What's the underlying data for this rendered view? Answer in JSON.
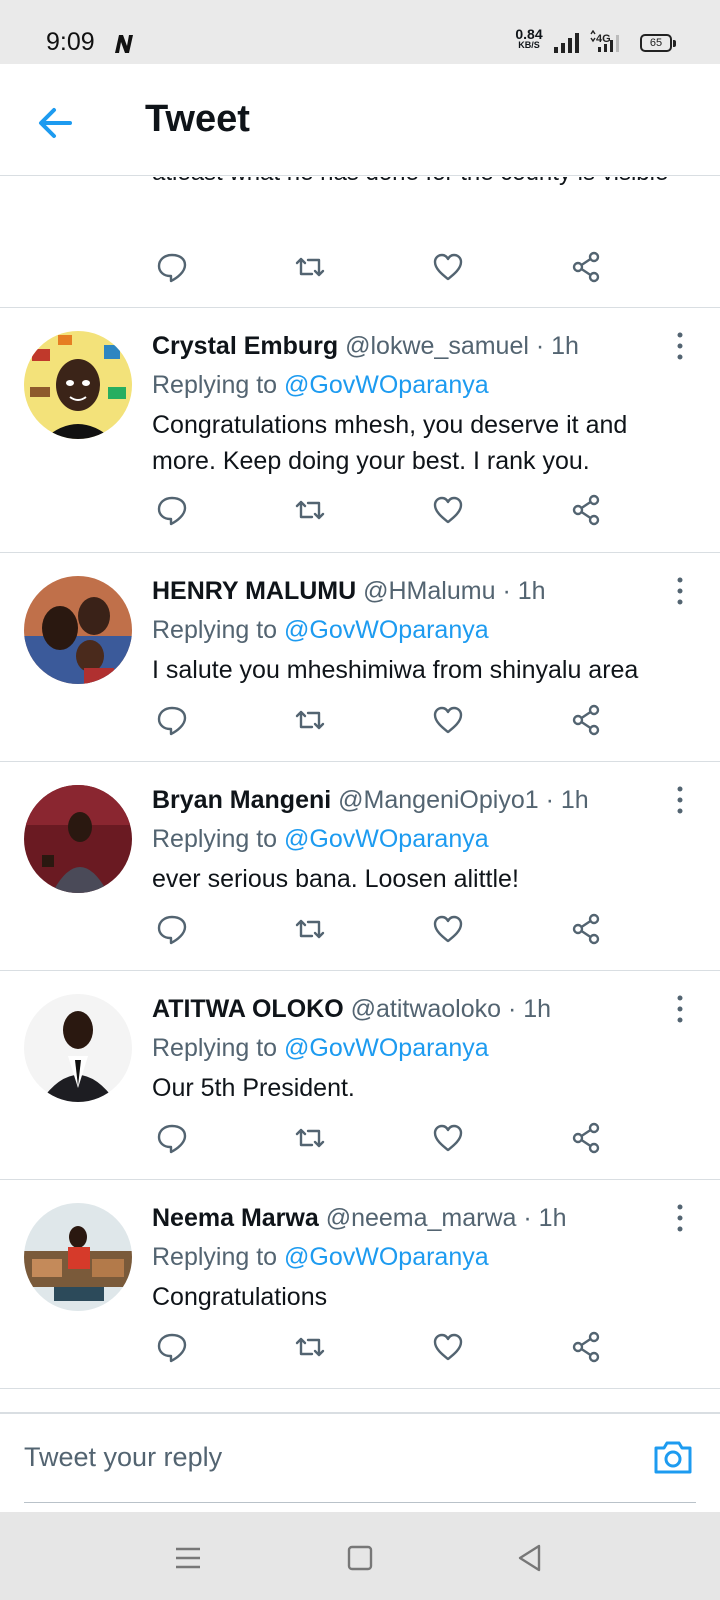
{
  "status_bar": {
    "time": "9:09",
    "net_speed_value": "0.84",
    "net_speed_unit": "KB/S",
    "network_type": "4G",
    "battery": "65"
  },
  "header": {
    "title": "Tweet",
    "back_icon": "arrow-left-icon"
  },
  "partial_tweet": {
    "text": "atleast what he has done for the county is visible"
  },
  "replies": [
    {
      "name": "Crystal Emburg",
      "handle": "@lokwe_samuel",
      "time": "· 1h",
      "replying_prefix": "Replying to",
      "replying_to": "@GovWOparanya",
      "text": "Congratulations mhesh, you deserve it and more. Keep doing your best. I rank you."
    },
    {
      "name": "HENRY MALUMU",
      "handle": "@HMalumu",
      "time": "· 1h",
      "replying_prefix": "Replying to",
      "replying_to": "@GovWOparanya",
      "text": "I salute you mheshimiwa from shinyalu area"
    },
    {
      "name": "Bryan Mangeni",
      "handle": "@MangeniOpiyo1",
      "time": "· 1h",
      "replying_prefix": "Replying to",
      "replying_to": "@GovWOparanya",
      "text": "ever serious bana. Loosen alittle!"
    },
    {
      "name": "ATITWA OLOKO",
      "handle": "@atitwaoloko",
      "time": "· 1h",
      "replying_prefix": "Replying to",
      "replying_to": "@GovWOparanya",
      "text": "Our 5th President."
    },
    {
      "name": "Neema Marwa",
      "handle": "@neema_marwa",
      "time": "· 1h",
      "replying_prefix": "Replying to",
      "replying_to": "@GovWOparanya",
      "text": "Congratulations"
    }
  ],
  "composer": {
    "placeholder": "Tweet your reply",
    "camera_icon": "camera-icon"
  },
  "nav_bar": {
    "icons": [
      "menu-icon",
      "home-square-icon",
      "back-triangle-icon"
    ]
  },
  "colors": {
    "accent": "#1d9bf0",
    "secondary_text": "#536471",
    "divider": "#d9dee2"
  }
}
